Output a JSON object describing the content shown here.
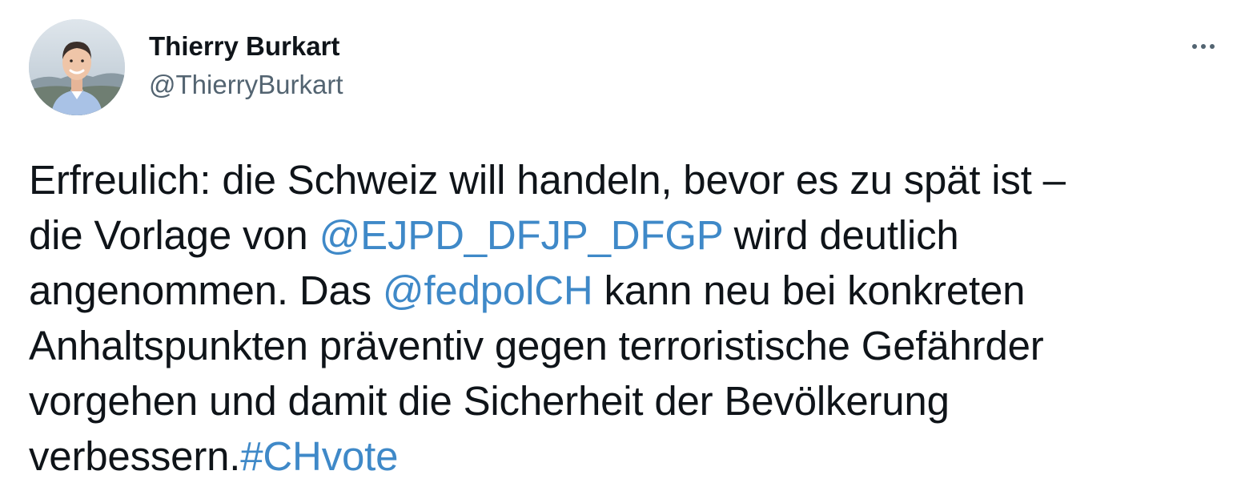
{
  "author": {
    "name": "Thierry Burkart",
    "handle": "@ThierryBurkart"
  },
  "menu": {
    "more_icon": "more-horizontal-icon"
  },
  "tweet": {
    "line1": "Erfreulich: die Schweiz will handeln, bevor es zu spät ist –",
    "line2_pre": "die Vorlage von ",
    "mention1": "@EJPD_DFJP_DFGP",
    "line2_post": " wird deutlich",
    "line3_pre": "angenommen. Das ",
    "mention2": "@fedpolCH",
    "line3_post": " kann neu bei konkreten",
    "line4": "Anhaltspunkten präventiv gegen terroristische Gefährder",
    "line5": "vorgehen und damit die Sicherheit der Bevölkerung",
    "line6_pre": "verbessern.",
    "hashtag": "#CHvote"
  },
  "colors": {
    "link": "#3f89c8",
    "text": "#0f1419",
    "secondary": "#536471"
  }
}
